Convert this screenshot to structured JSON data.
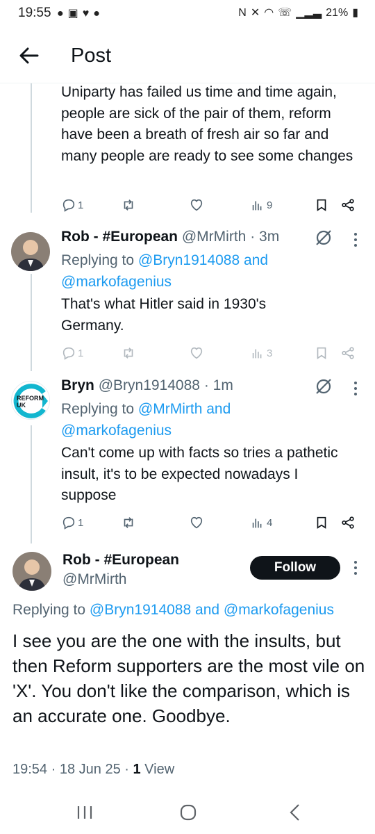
{
  "status_bar": {
    "time": "19:55",
    "battery": "21%",
    "left_icons": [
      "chat-bubble-icon",
      "image-icon",
      "heart-icon",
      "chat-bubble-icon"
    ],
    "right_icons": [
      "nfc-icon",
      "mute-icon",
      "wifi-icon",
      "wifi-call-icon",
      "signal-icon",
      "battery-icon"
    ]
  },
  "header": {
    "title": "Post"
  },
  "posts": [
    {
      "text": "Uniparty has failed us time and time again, people are sick of the pair of them, reform have been a breath of fresh air so far and many people are ready to see some changes",
      "replies": "1",
      "views": "9"
    },
    {
      "name": "Rob - #European",
      "handle": "@MrMirth",
      "time": "3m",
      "replying_prefix": "Replying to",
      "replying_user1": "@Bryn1914088",
      "replying_and": "and",
      "replying_user2": "@markofagenius",
      "text": "That's what Hitler said in 1930's Germany.",
      "replies": "1",
      "views": "3"
    },
    {
      "name": "Bryn",
      "handle": "@Bryn1914088",
      "time": "1m",
      "avatar_text": "REFORM UK",
      "replying_prefix": "Replying to",
      "replying_user1": "@MrMirth",
      "replying_and": "and",
      "replying_user2": "@markofagenius",
      "text": "Can't come up with facts so tries a pathetic insult, it's to be expected nowadays I suppose",
      "replies": "1",
      "views": "4"
    }
  ],
  "main_post": {
    "name": "Rob - #European",
    "handle": "@MrMirth",
    "follow_label": "Follow",
    "replying_prefix": "Replying to",
    "replying_user1": "@Bryn1914088",
    "replying_and": "and",
    "replying_user2": "@markofagenius",
    "text": "I see you are the one with the insults, but then Reform supporters are the most vile on 'X'.   You don't like the comparison, which is an accurate one. Goodbye.",
    "time": "19:54",
    "date": "18 Jun 25",
    "views_count": "1",
    "views_label": "View"
  },
  "colors": {
    "accent": "#1d9bf0",
    "text": "#0f1419",
    "muted": "#536471",
    "reform": "#12b6cf"
  }
}
